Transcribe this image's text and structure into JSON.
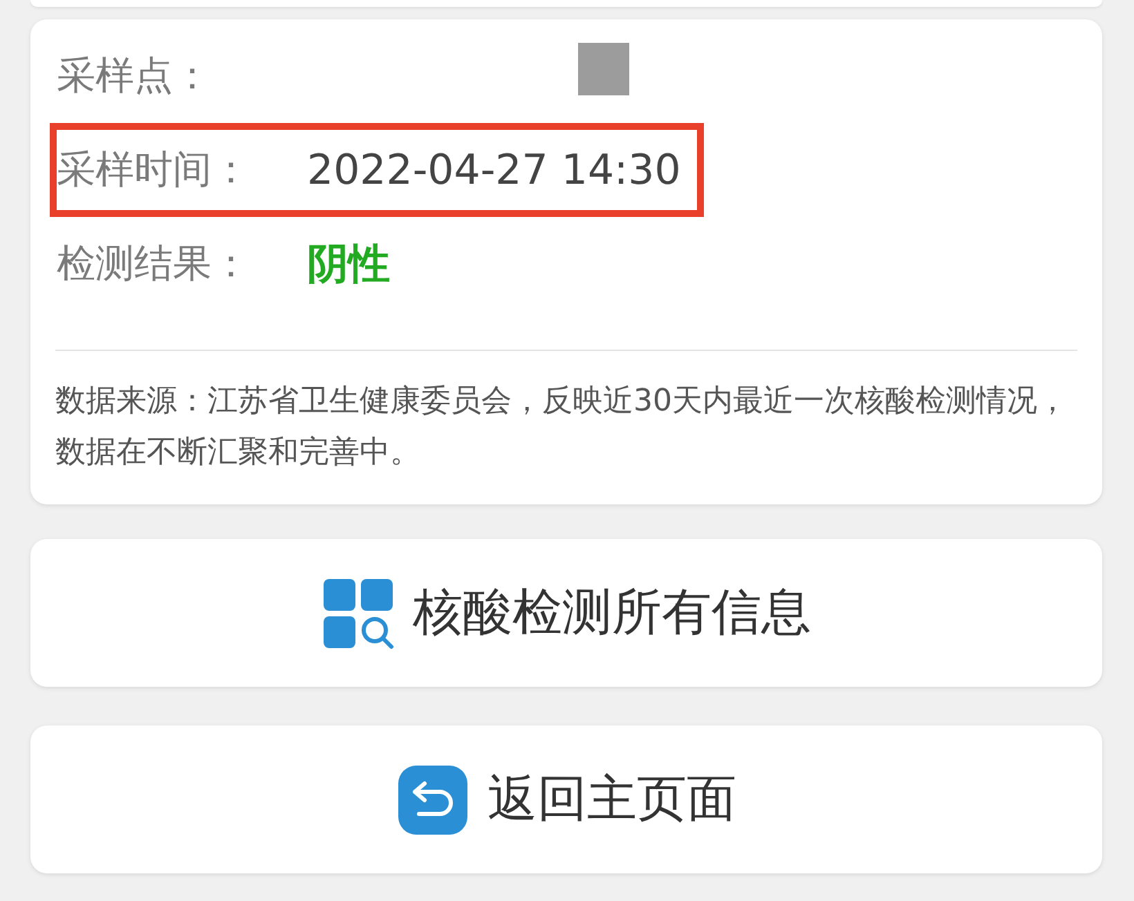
{
  "result_card": {
    "rows": [
      {
        "kind": "text",
        "label": "采样点：",
        "value": "",
        "redacted": true,
        "highlighted": false
      },
      {
        "kind": "text",
        "label": "采样时间：",
        "value": "2022-04-27 14:30",
        "redacted": false,
        "highlighted": true
      },
      {
        "kind": "result",
        "label": "检测结果：",
        "value": "阴性",
        "redacted": false,
        "highlighted": false
      }
    ],
    "note": "数据来源：江苏省卫生健康委员会，反映近30天内最近一次核酸检测情况，数据在不断汇聚和完善中。"
  },
  "buttons": [
    {
      "kind": "grid-search",
      "label": "核酸检测所有信息"
    },
    {
      "kind": "back",
      "label": "返回主页面"
    }
  ]
}
